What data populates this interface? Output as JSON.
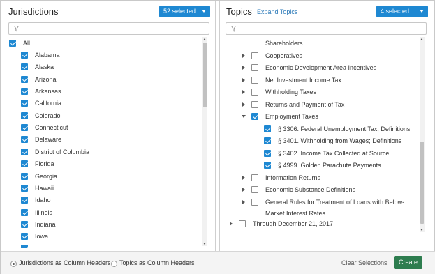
{
  "jurisdictions": {
    "title": "Jurisdictions",
    "selected_label": "52 selected",
    "filter_placeholder": "",
    "all_label": "All",
    "items": [
      "Alabama",
      "Alaska",
      "Arizona",
      "Arkansas",
      "California",
      "Colorado",
      "Connecticut",
      "Delaware",
      "District of Columbia",
      "Florida",
      "Georgia",
      "Hawaii",
      "Idaho",
      "Illinois",
      "Indiana",
      "Iowa"
    ]
  },
  "topics": {
    "title": "Topics",
    "expand_label": "Expand Topics",
    "selected_label": "4 selected",
    "filter_placeholder": "",
    "items": [
      {
        "label": "Shareholders",
        "checked": null,
        "arrow": "none"
      },
      {
        "label": "Cooperatives",
        "checked": false,
        "arrow": "right"
      },
      {
        "label": "Economic Development Area Incentives",
        "checked": false,
        "arrow": "right"
      },
      {
        "label": "Net Investment Income Tax",
        "checked": false,
        "arrow": "right"
      },
      {
        "label": "Withholding Taxes",
        "checked": false,
        "arrow": "right"
      },
      {
        "label": "Returns and Payment of Tax",
        "checked": false,
        "arrow": "right"
      },
      {
        "label": "Employment Taxes",
        "checked": true,
        "arrow": "down"
      },
      {
        "label": "§ 3306. Federal Unemployment Tax; Definitions",
        "checked": true,
        "arrow": "none"
      },
      {
        "label": "§ 3401. Withholding from Wages; Definitions",
        "checked": true,
        "arrow": "none"
      },
      {
        "label": "§ 3402. Income Tax Collected at Source",
        "checked": true,
        "arrow": "none"
      },
      {
        "label": "§ 4999. Golden Parachute Payments",
        "checked": true,
        "arrow": "none"
      },
      {
        "label": "Information Returns",
        "checked": false,
        "arrow": "right"
      },
      {
        "label": "Economic Substance Definitions",
        "checked": false,
        "arrow": "right"
      },
      {
        "label": "General Rules for Treatment of Loans with Below-",
        "label2": "Market Interest Rates",
        "checked": false,
        "arrow": "right"
      },
      {
        "label": "Through December 21, 2017",
        "checked": false,
        "arrow": "right"
      }
    ]
  },
  "footer": {
    "radio_jurisdictions": "Jurisdictions as Column Headers",
    "radio_topics": "Topics as Column Headers",
    "clear_label": "Clear Selections",
    "create_label": "Create"
  },
  "colors": {
    "accent": "#1e88d2",
    "create": "#2e7d4f",
    "link": "#2a79b8"
  }
}
